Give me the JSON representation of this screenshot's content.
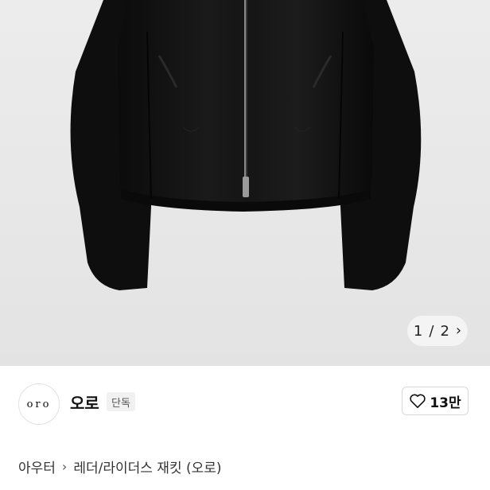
{
  "product_image": {
    "pager": {
      "current": "1",
      "separator": "/",
      "total": "2"
    },
    "icon": "chevron-right-icon"
  },
  "brand": {
    "logo_text": "oro",
    "name": "오로",
    "badge": "단독",
    "likes": "13만",
    "like_icon": "heart-outline-icon"
  },
  "breadcrumb": {
    "category": "아우터",
    "subcategory": "레더/라이더스 재킷 (오로)",
    "separator_icon": "chevron-right-icon"
  },
  "colors": {
    "image_background": "#e8e8e8",
    "jacket": "#121212"
  }
}
